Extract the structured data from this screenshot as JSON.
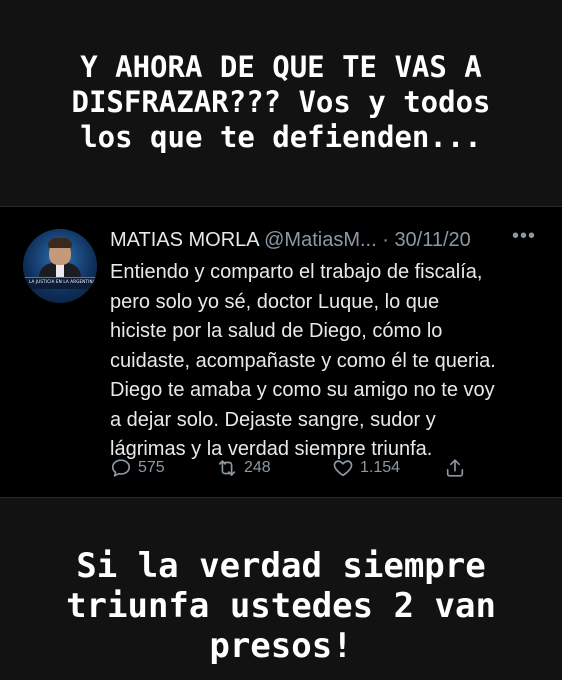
{
  "top_caption": {
    "lines": [
      "Y AHORA DE QUE TE VAS A",
      "DISFRAZAR??? Vos y todos",
      "los que te defienden..."
    ]
  },
  "tweet": {
    "author_name": "MATIAS MORLA",
    "handle": "@MatiasM...",
    "separator": " · ",
    "date": "30/11/20",
    "more_icon": "more-icon",
    "avatar_caption": "LA JUSTICIA EN LA ARGENTINA",
    "text_lines": [
      "Entiendo y comparto el trabajo de fiscalía,",
      "pero solo yo sé, doctor Luque, lo que",
      "hiciste por la salud de Diego, cómo lo",
      "cuidaste, acompañaste y como él te queria.",
      "Diego te amaba y como su amigo no te voy",
      "a dejar solo. Dejaste sangre, sudor y",
      "lágrimas y la verdad siempre triunfa."
    ],
    "actions": {
      "replies": "575",
      "retweets": "248",
      "likes": "1.154"
    },
    "colors": {
      "text": "#e7e9ea",
      "muted": "#8b98a5",
      "background": "#000000"
    }
  },
  "bottom_caption": {
    "lines": [
      "Si la verdad siempre",
      "triunfa ustedes 2 van",
      "presos!"
    ]
  },
  "background_color": "#121212"
}
